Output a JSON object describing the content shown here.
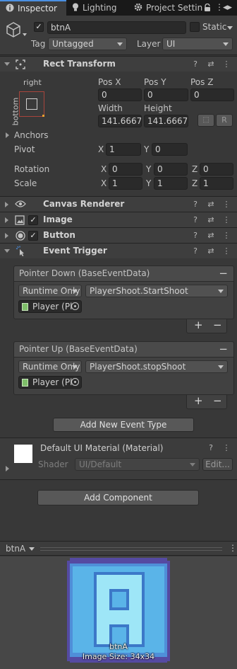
{
  "tabs": [
    {
      "label": "Inspector",
      "icon": "info-icon"
    },
    {
      "label": "Lighting",
      "icon": "bulb-icon"
    },
    {
      "label": "Project Settin",
      "icon": "gear-icon"
    }
  ],
  "gameobject": {
    "name": "btnA",
    "active": true,
    "static_label": "Static",
    "tag_label": "Tag",
    "tag_value": "Untagged",
    "layer_label": "Layer",
    "layer_value": "UI"
  },
  "rect_transform": {
    "title": "Rect Transform",
    "anchor_h": "right",
    "anchor_v": "bottom",
    "pos_x_label": "Pos X",
    "pos_x": "0",
    "pos_y_label": "Pos Y",
    "pos_y": "0",
    "pos_z_label": "Pos Z",
    "pos_z": "0",
    "width_label": "Width",
    "width": "141.6667",
    "height_label": "Height",
    "height": "141.6667",
    "r_button": "R",
    "anchors_label": "Anchors",
    "pivot_label": "Pivot",
    "pivot_x": "1",
    "pivot_y": "0",
    "rotation_label": "Rotation",
    "rot_x": "0",
    "rot_y": "0",
    "rot_z": "0",
    "scale_label": "Scale",
    "scale_x": "1",
    "scale_y": "1",
    "scale_z": "1",
    "x": "X",
    "y": "Y",
    "z": "Z"
  },
  "components": {
    "canvas_renderer": "Canvas Renderer",
    "image": "Image",
    "button": "Button",
    "event_trigger": "Event Trigger"
  },
  "events": [
    {
      "header": "Pointer Down (BaseEventData)",
      "runtime": "Runtime Only",
      "function": "PlayerShoot.StartShoot",
      "target": "Player (Pl"
    },
    {
      "header": "Pointer Up (BaseEventData)",
      "runtime": "Runtime Only",
      "function": "PlayerShoot.stopShoot",
      "target": "Player (Pl"
    }
  ],
  "add_event_type": "Add New Event Type",
  "material": {
    "name": "Default UI Material (Material)",
    "shader_label": "Shader",
    "shader_value": "UI/Default",
    "edit_label": "Edit..."
  },
  "add_component": "Add Component",
  "preview": {
    "title": "btnA",
    "caption_name": "btnA",
    "caption_size": "Image Size: 34x34"
  },
  "colors": {
    "accent": "#4a90e2",
    "sprite_fill": "#5ab4e8",
    "sprite_border": "#5a4fa8",
    "sprite_letter": "#9ee6f7"
  }
}
